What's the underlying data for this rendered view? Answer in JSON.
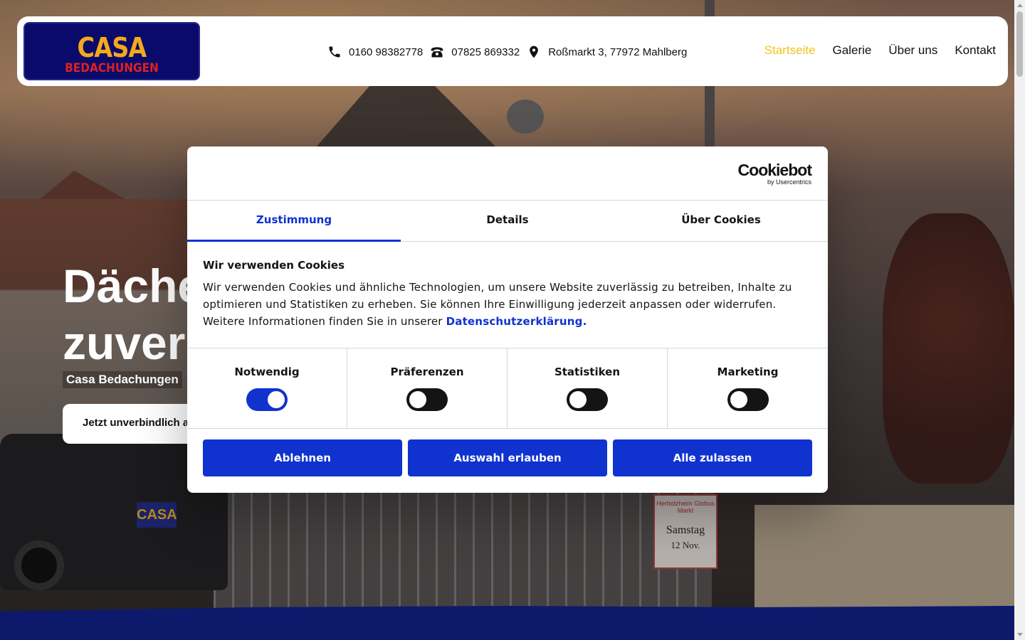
{
  "header": {
    "logo": {
      "top": "CASA",
      "bottom": "BEDACHUNGEN"
    },
    "contacts": [
      {
        "icon": "phone-icon",
        "text": "0160 98382778"
      },
      {
        "icon": "landline-phone-icon",
        "text": "07825 869332"
      },
      {
        "icon": "location-pin-icon",
        "text": "Roßmarkt 3, 77972 Mahlberg"
      }
    ],
    "nav": [
      {
        "label": "Startseite",
        "active": true
      },
      {
        "label": "Galerie",
        "active": false
      },
      {
        "label": "Über uns",
        "active": false
      },
      {
        "label": "Kontakt",
        "active": false
      }
    ]
  },
  "hero": {
    "title_line1": "Dächer",
    "title_line2": "zuverlässig",
    "subtitle": "Casa Bedachungen",
    "cta": "Jetzt unverbindlich anfragen",
    "truck_sign": "CASA",
    "banner": {
      "top": "Herbolzheim Globus Markt",
      "main": "Samstag",
      "date": "12 Nov."
    }
  },
  "cookie_modal": {
    "brand": {
      "name": "Cookiebot",
      "by": "by Usercentrics"
    },
    "tabs": [
      {
        "label": "Zustimmung",
        "active": true
      },
      {
        "label": "Details",
        "active": false
      },
      {
        "label": "Über Cookies",
        "active": false
      }
    ],
    "title": "Wir verwenden Cookies",
    "text": "Wir verwenden Cookies und ähnliche Technologien, um unsere Website zuverlässig zu betreiben, Inhalte zu optimieren und Statistiken zu erheben. Sie können Ihre Einwilligung jederzeit anpassen oder widerrufen. Weitere Informationen finden Sie in unserer ",
    "link": "Datenschutzerklärung.",
    "toggles": [
      {
        "label": "Notwendig",
        "checked": true
      },
      {
        "label": "Präferenzen",
        "checked": false
      },
      {
        "label": "Statistiken",
        "checked": false
      },
      {
        "label": "Marketing",
        "checked": false
      }
    ],
    "buttons": {
      "decline": "Ablehnen",
      "allow_selection": "Auswahl erlauben",
      "allow_all": "Alle zulassen"
    }
  },
  "colors": {
    "accent_blue": "#1032cf",
    "nav_active": "#f0c419",
    "logo_bg": "#0a0a6b",
    "logo_orange": "#f5a81c",
    "logo_red": "#e02020",
    "footer_wave": "#0d1a6b"
  }
}
